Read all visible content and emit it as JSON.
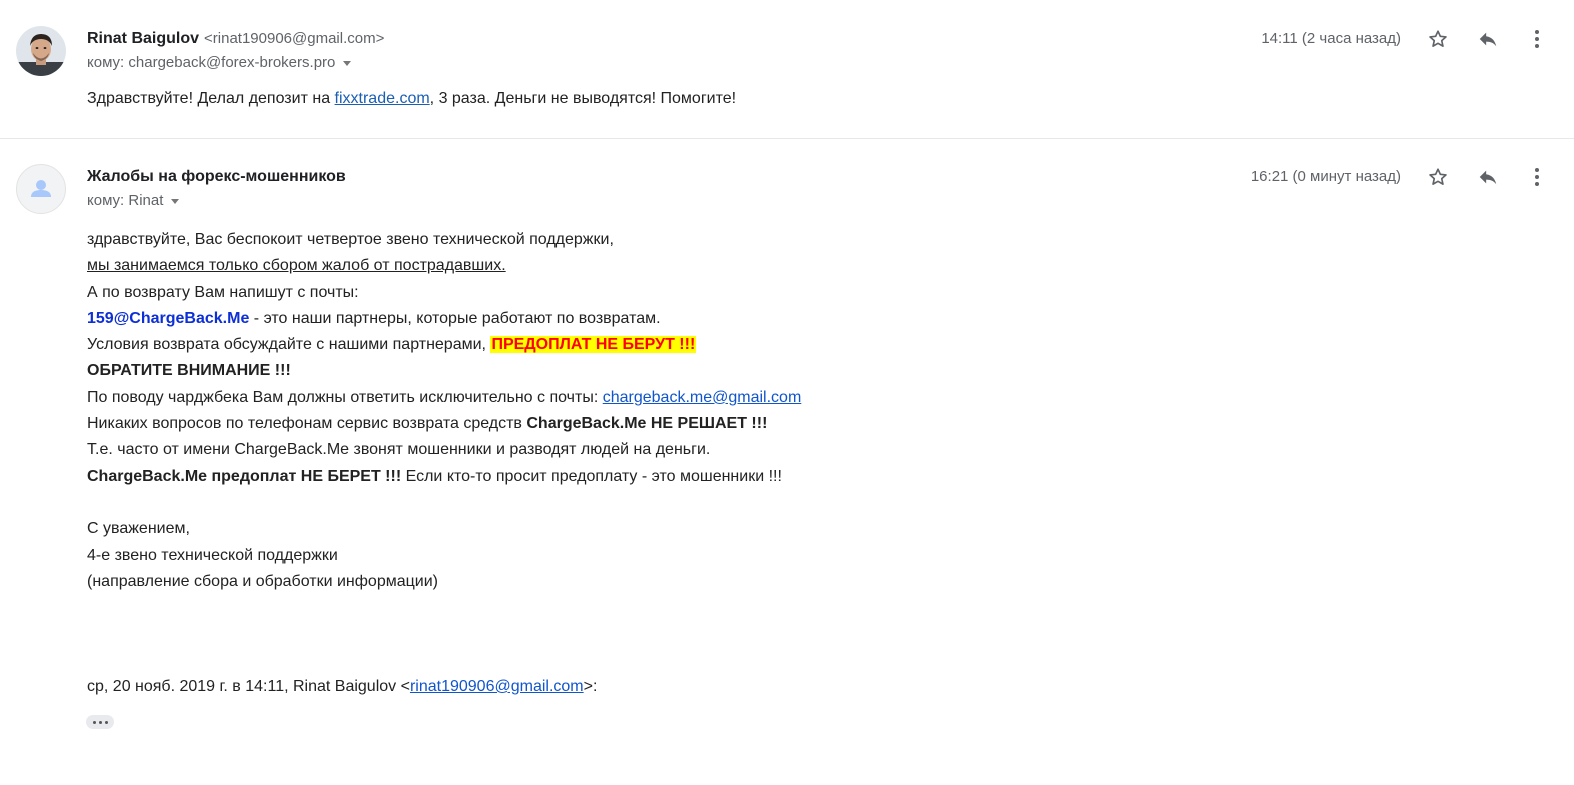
{
  "messages": [
    {
      "sender_name": "Rinat Baigulov",
      "sender_email": "<rinat190906@gmail.com>",
      "to": "кому: chargeback@forex-brokers.pro",
      "time": "14:11 (2 часа назад)",
      "body": {
        "before_link": "Здравствуйте! Делал депозит на ",
        "link": "fixxtrade.com",
        "after_link": ", 3 раза. Деньги не выводятся! Помогите!"
      }
    },
    {
      "sender_name": "Жалобы на форекс-мошенников",
      "to": "кому: Rinat",
      "time": "16:21 (0 минут назад)",
      "body": {
        "l1": "здравствуйте, Вас беспокоит четвертое звено технической поддержки,",
        "l2": "мы занимаемся только сбором жалоб от пострадавших.",
        "l3": "А по возврату Вам напишут с почты:",
        "l4_email": "159@ChargeBack.Me",
        "l4_rest": " - это наши партнеры, которые работают по возвратам.",
        "l5_text": "Условия возврата обсуждайте с нашими партнерами, ",
        "l5_warn": "ПРЕДОПЛАТ НЕ БЕРУТ !!!",
        "l6": "ОБРАТИТЕ ВНИМАНИЕ !!!",
        "l7_text": "По поводу чарджбека Вам должны ответить исключительно с почты: ",
        "l7_link": "chargeback.me@gmail.com",
        "l8_text": "Никаких вопросов по телефонам сервис возврата средств ",
        "l8_bold": "ChargeBack.Me НЕ РЕШАЕТ !!!",
        "l9": "Т.е. часто от имени ChargeBack.Me звонят мошенники и разводят людей на деньги.",
        "l10_bold": "ChargeBack.Me предоплат НЕ БЕРЕТ !!!",
        "l10_rest": " Если кто-то просит предоплату - это мошенники !!!",
        "sig1": "С уважением,",
        "sig2": "4-е звено технической поддержки",
        "sig3": "(направление сбора и обработки информации)"
      },
      "quote": {
        "prefix": "ср, 20 нояб. 2019 г. в 14:11, Rinat Baigulov <",
        "email": "rinat190906@gmail.com",
        "suffix": ">:"
      }
    }
  ],
  "icons": {
    "star": "star-icon",
    "reply": "reply-icon",
    "more": "more-vert-icon",
    "avatar_placeholder": "person-icon"
  },
  "colors": {
    "link": "#1a5fb4",
    "sender_email_bold": "#0d2fd6",
    "warning_bg": "#ffff00",
    "warning_text": "#ff0000"
  }
}
